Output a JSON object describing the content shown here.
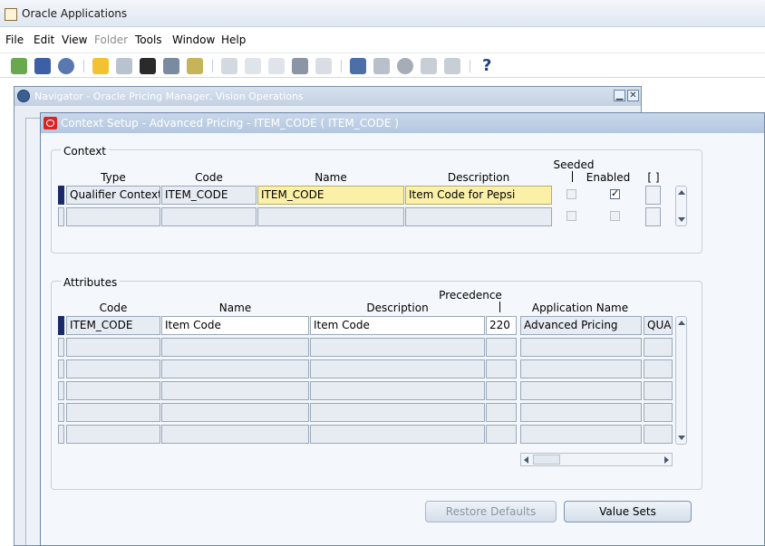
{
  "app": {
    "title": "Oracle Applications"
  },
  "menu": {
    "file": "File",
    "edit": "Edit",
    "view": "View",
    "folder": "Folder",
    "tools": "Tools",
    "window": "Window",
    "help": "Help"
  },
  "toolbar": {
    "help": "?"
  },
  "navigator": {
    "title": "Navigator - Oracle Pricing Manager, Vision Operations",
    "minimize": "▁",
    "close": "✕"
  },
  "context_setup": {
    "title": "Context Setup - Advanced Pricing - ITEM_CODE ( ITEM_CODE )",
    "context": {
      "label": "Context",
      "headers": {
        "type": "Type",
        "code": "Code",
        "name": "Name",
        "description": "Description",
        "seeded": "Seeded",
        "enabled": "Enabled",
        "flex": "[ ]"
      },
      "rows": [
        {
          "type": "Qualifier Context",
          "code": "ITEM_CODE",
          "name": "ITEM_CODE",
          "description": "Item Code for Pepsi",
          "seeded": false,
          "enabled": true
        },
        {
          "type": "",
          "code": "",
          "name": "",
          "description": "",
          "seeded": false,
          "enabled": false
        }
      ]
    },
    "attributes": {
      "label": "Attributes",
      "headers": {
        "code": "Code",
        "name": "Name",
        "description": "Description",
        "precedence": "Precedence",
        "application": "Application Name"
      },
      "rows": [
        {
          "code": "ITEM_CODE",
          "name": "Item Code",
          "description": "Item Code",
          "precedence": "220",
          "application": "Advanced Pricing",
          "extra": "QUA"
        },
        {
          "code": "",
          "name": "",
          "description": "",
          "precedence": "",
          "application": "",
          "extra": ""
        },
        {
          "code": "",
          "name": "",
          "description": "",
          "precedence": "",
          "application": "",
          "extra": ""
        },
        {
          "code": "",
          "name": "",
          "description": "",
          "precedence": "",
          "application": "",
          "extra": ""
        },
        {
          "code": "",
          "name": "",
          "description": "",
          "precedence": "",
          "application": "",
          "extra": ""
        },
        {
          "code": "",
          "name": "",
          "description": "",
          "precedence": "",
          "application": "",
          "extra": ""
        }
      ]
    },
    "buttons": {
      "restore_defaults": "Restore Defaults",
      "value_sets": "Value Sets"
    }
  }
}
